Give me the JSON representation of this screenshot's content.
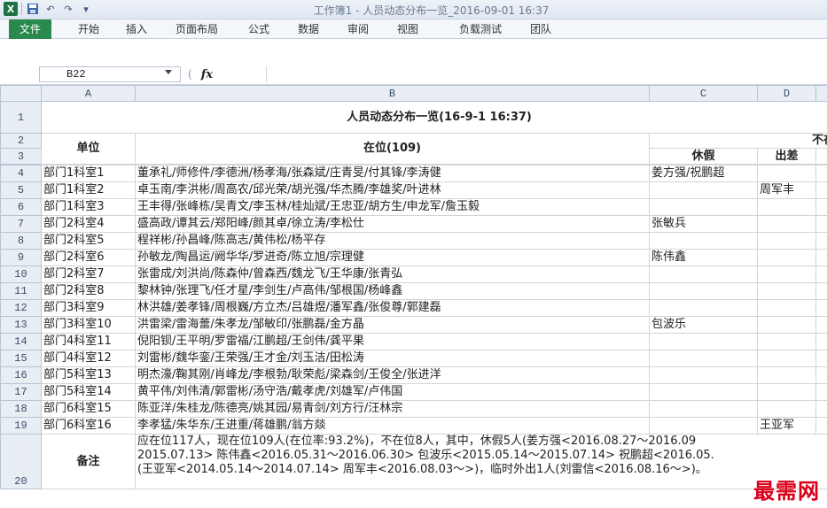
{
  "window": {
    "title": "工作簿1 - 人员动态分布一览_2016-09-01 16:37"
  },
  "qat": {
    "app_icon": "X",
    "save_icon": "save-icon",
    "undo_glyph": "↶",
    "redo_glyph": "↷",
    "customize_glyph": "▾"
  },
  "ribbon": {
    "tabs": [
      "文件",
      "开始",
      "插入",
      "页面布局",
      "公式",
      "数据",
      "审阅",
      "视图",
      "负载测试",
      "团队"
    ]
  },
  "formula_bar": {
    "name_box": "B22",
    "fx_label": "fx",
    "cancel_glyph": "(",
    "value": ""
  },
  "columns": [
    "A",
    "B",
    "C",
    "D"
  ],
  "sheet": {
    "title": "人员动态分布一览(16-9-1 16:37)",
    "header": {
      "unit": "单位",
      "present": "在位(109)",
      "absent_group": "不在",
      "leave": "休假",
      "trip": "出差"
    },
    "rows": [
      {
        "n": "4",
        "unit": "部门1科室1",
        "present": "董承礼/师修件/李德洲/杨孝海/张森斌/庄青旻/付其锋/李涛健",
        "leave": "姜方强/祝鹏超",
        "trip": ""
      },
      {
        "n": "5",
        "unit": "部门1科室2",
        "present": "卓玉南/李洪彬/周高农/邱光荣/胡光强/华杰腾/李雄奖/叶进林",
        "leave": "",
        "trip": "周军丰"
      },
      {
        "n": "6",
        "unit": "部门1科室3",
        "present": "王丰得/张峰栋/吴青文/李玉林/桂灿斌/王忠亚/胡方生/申龙军/詹玉毅",
        "leave": "",
        "trip": ""
      },
      {
        "n": "7",
        "unit": "部门2科室4",
        "present": "盛高政/谭其云/郑阳峰/颜其卓/徐立涛/李松仕",
        "leave": "张敏兵",
        "trip": ""
      },
      {
        "n": "8",
        "unit": "部门2科室5",
        "present": "程祥彬/孙昌峰/陈高志/黄伟松/杨平存",
        "leave": "",
        "trip": ""
      },
      {
        "n": "9",
        "unit": "部门2科室6",
        "present": "孙敏龙/陶昌运/阙华华/罗进奇/陈立旭/宗理健",
        "leave": "陈伟鑫",
        "trip": ""
      },
      {
        "n": "10",
        "unit": "部门2科室7",
        "present": "张雷成/刘洪尚/陈森仲/曾森西/魏龙飞/王华康/张青弘",
        "leave": "",
        "trip": ""
      },
      {
        "n": "11",
        "unit": "部门2科室8",
        "present": "黎林钟/张理飞/任才星/李剑生/卢高伟/邹根国/杨峰鑫",
        "leave": "",
        "trip": ""
      },
      {
        "n": "12",
        "unit": "部门3科室9",
        "present": "林洪雄/姜孝锋/周根巍/方立杰/吕雄煜/潘军鑫/张俊尊/郭建磊",
        "leave": "",
        "trip": ""
      },
      {
        "n": "13",
        "unit": "部门3科室10",
        "present": "洪雷梁/雷海蕾/朱孝龙/邹敏印/张鹏磊/金方晶",
        "leave": "包波乐",
        "trip": ""
      },
      {
        "n": "14",
        "unit": "部门4科室11",
        "present": "倪阳钡/王平明/罗雷福/江鹏超/王剑伟/龚平果",
        "leave": "",
        "trip": ""
      },
      {
        "n": "15",
        "unit": "部门4科室12",
        "present": "刘雷彬/魏华銮/王荣强/王才金/刘玉洁/田松涛",
        "leave": "",
        "trip": ""
      },
      {
        "n": "16",
        "unit": "部门5科室13",
        "present": "明杰濠/鞠其刚/肖峰龙/李根勃/耿荣彪/梁森剑/王俊全/张进洋",
        "leave": "",
        "trip": ""
      },
      {
        "n": "17",
        "unit": "部门5科室14",
        "present": "黄平伟/刘伟清/郭雷彬/汤守浩/戴孝虎/刘雄军/卢伟国",
        "leave": "",
        "trip": ""
      },
      {
        "n": "18",
        "unit": "部门6科室15",
        "present": "陈亚洋/朱桂龙/陈德亮/姚其园/易青剑/刘方行/汪林宗",
        "leave": "",
        "trip": ""
      },
      {
        "n": "19",
        "unit": "部门6科室16",
        "present": "李孝猛/朱华东/王进重/蒋雄鹏/翁方燚",
        "leave": "",
        "trip": "王亚军"
      }
    ],
    "notes_label": "备注",
    "notes_lines": [
      "应在位117人，现在位109人(在位率:93.2%)，不在位8人，其中，休假5人(姜方强<2016.08.27～2016.09",
      "2015.07.13> 陈伟鑫<2016.05.31～2016.06.30> 包波乐<2015.05.14～2015.07.14> 祝鹏超<2016.05.",
      "(王亚军<2014.05.14～2014.07.14> 周军丰<2016.08.03～>)，临时外出1人(刘雷信<2016.08.16～>)。"
    ]
  },
  "watermark": "最需网"
}
